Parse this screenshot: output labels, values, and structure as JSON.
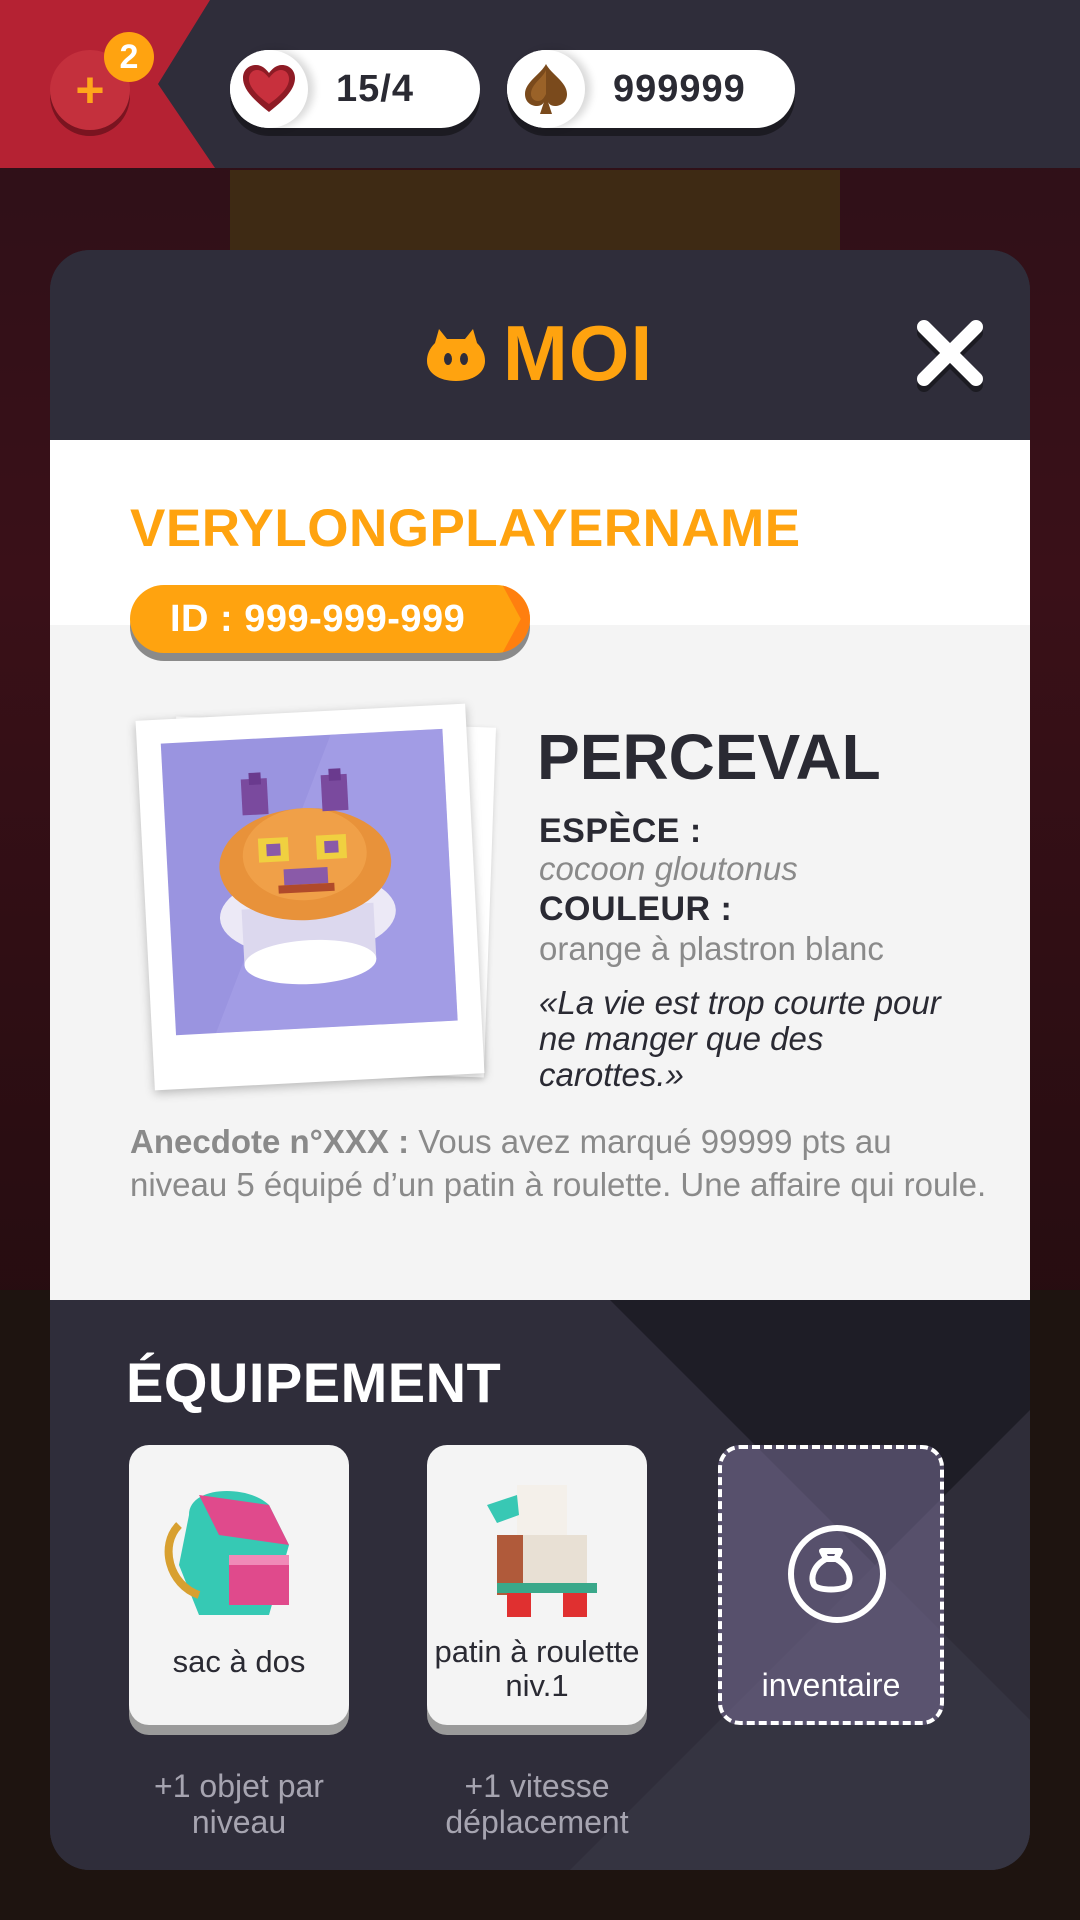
{
  "topbar": {
    "level_badge": "2",
    "plus_symbol": "+",
    "lives": "15/4",
    "coins": "999999",
    "lives_icon": "heart-icon",
    "coins_icon": "spade-icon"
  },
  "modal": {
    "title": "MOI",
    "title_icon": "critter-head-icon",
    "close_icon": "close-icon"
  },
  "profile": {
    "player_name": "VERYLONGPLAYERNAME",
    "id_label": "ID : 999-999-999",
    "pet_name": "PERCEVAL",
    "species_label": "ESPÈCE :",
    "species_value": "cocoon gloutonus",
    "color_label": "COULEUR :",
    "color_value": "orange à plastron blanc",
    "quote": "«La vie est trop courte pour ne manger que des carottes.»",
    "anecdote_label": "Anecdote n°XXX :",
    "anecdote_text": " Vous avez marqué 99999 pts au niveau 5 équipé d’un patin à roulette. Une affaire qui roule."
  },
  "equipment": {
    "title": "ÉQUIPEMENT",
    "items": [
      {
        "label": "sac à dos",
        "bonus": "+1 objet par niveau",
        "icon": "backpack-icon"
      },
      {
        "label": "patin à roulette niv.1",
        "bonus": "+1 vitesse déplacement",
        "icon": "roller-skate-icon"
      }
    ],
    "inventory_label": "inventaire",
    "inventory_icon": "bag-icon"
  },
  "colors": {
    "accent": "#ffa30f",
    "panel_dark": "#2f2d3a",
    "level_tab": "#b52233"
  }
}
